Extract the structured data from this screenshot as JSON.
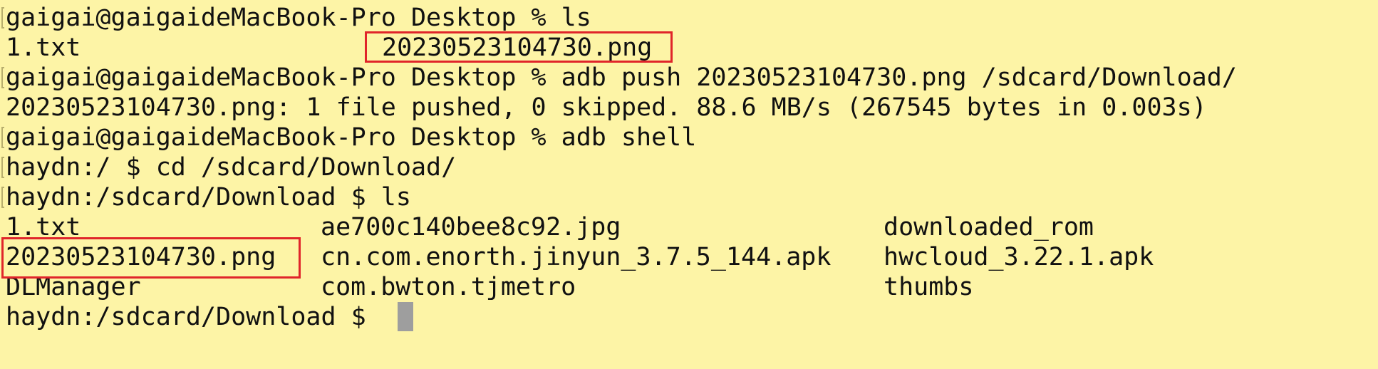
{
  "terminal": {
    "bg_color": "#fdf4a6",
    "text_color": "#111111",
    "highlight_color": "#e0252a",
    "cursor_color": "#9e9e9e",
    "lines": [
      "gaigai@gaigaideMacBook-Pro Desktop % ls",
      "1.txt",
      "20230523104730.png",
      "gaigai@gaigaideMacBook-Pro Desktop % adb push 20230523104730.png /sdcard/Download/",
      "20230523104730.png: 1 file pushed, 0 skipped. 88.6 MB/s (267545 bytes in 0.003s)",
      "gaigai@gaigaideMacBook-Pro Desktop % adb shell",
      "haydn:/ $ cd /sdcard/Download/",
      "haydn:/sdcard/Download $ ls"
    ],
    "listing": {
      "col1": [
        "1.txt",
        "20230523104730.png",
        "DLManager"
      ],
      "col2": [
        "ae700c140bee8c92.jpg",
        "cn.com.enorth.jinyun_3.7.5_144.apk",
        "com.bwton.tjmetro"
      ],
      "col3": [
        "downloaded_rom",
        "hwcloud_3.22.1.apk",
        "thumbs"
      ]
    },
    "prompt": "haydn:/sdcard/Download $ "
  }
}
